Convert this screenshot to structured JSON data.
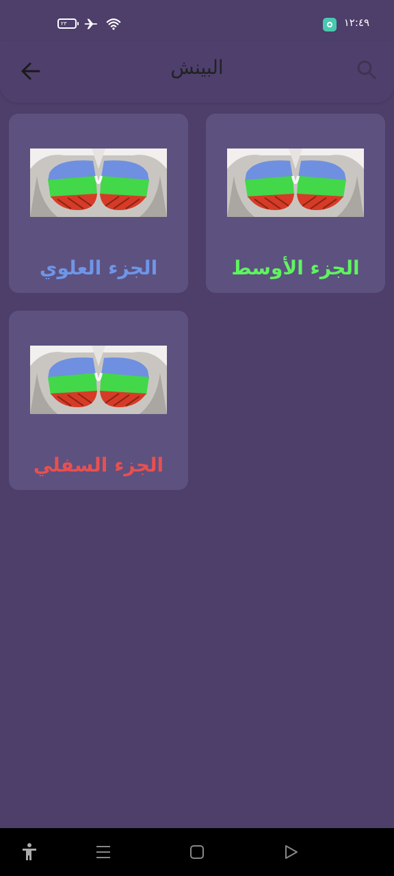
{
  "status_bar": {
    "time": "١٢:٤٩",
    "battery_level": "٢٣"
  },
  "header": {
    "title": "البينش"
  },
  "cards": [
    {
      "label": "الجزء الأوسط",
      "color": "#5ef55e"
    },
    {
      "label": "الجزء العلوي",
      "color": "#6e96e8"
    },
    {
      "label": "الجزء السفلي",
      "color": "#e85050"
    }
  ],
  "icons": {
    "back": "arrow-left-icon",
    "search": "search-icon",
    "nav": [
      "accessibility-icon",
      "menu-icon",
      "home-icon",
      "back-triangle-icon"
    ]
  },
  "colors": {
    "background": "#4d3e6a",
    "card": "#5d5180",
    "nav_bar": "#000000"
  }
}
